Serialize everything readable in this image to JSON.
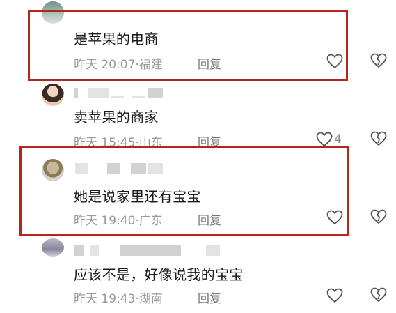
{
  "comments": [
    {
      "text": "是苹果的电商",
      "time": "昨天 20:07",
      "location": "福建",
      "reply_label": "回复",
      "like_count": null
    },
    {
      "text": "卖苹果的商家",
      "time": "昨天 15:45",
      "location": "山东",
      "reply_label": "回复",
      "like_count": "4"
    },
    {
      "text": "她是说家里还有宝宝",
      "time": "昨天 19:40",
      "location": "广东",
      "reply_label": "回复",
      "like_count": null
    },
    {
      "text": "应该不是，好像说我的宝宝",
      "time": "昨天 19:43",
      "location": "湖南",
      "reply_label": "回复",
      "like_count": null
    }
  ],
  "separator": "·",
  "colors": {
    "highlight": "#b3261e",
    "meta": "#9a9a9a",
    "text": "#1a1a1a"
  }
}
